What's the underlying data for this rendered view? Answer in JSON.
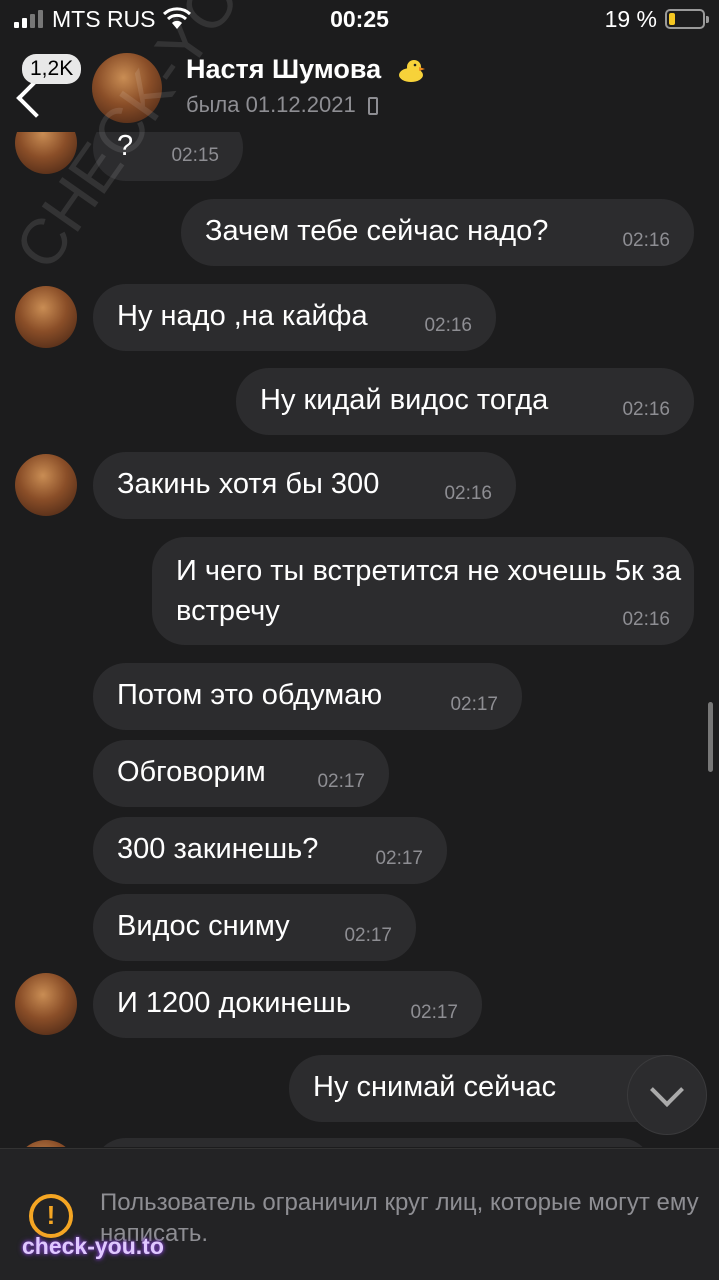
{
  "status_bar": {
    "carrier": "MTS RUS",
    "time": "00:25",
    "battery_percent_label": "19 %",
    "battery_level": 0.19,
    "icons": [
      "signal-icon",
      "wifi-icon",
      "battery-icon"
    ]
  },
  "header": {
    "unread_count": "1,2K",
    "contact_name": "Настя Шумова",
    "last_seen": "была 01.12.2021",
    "icons": [
      "back-chevron-icon",
      "duck-emoji-icon",
      "phone-device-icon"
    ]
  },
  "messages": [
    {
      "side": "in",
      "text": "?",
      "time": "02:15"
    },
    {
      "side": "out",
      "text": "Зачем тебе сейчас надо?",
      "time": "02:16"
    },
    {
      "side": "in",
      "text": "Ну надо ,на кайфа",
      "time": "02:16"
    },
    {
      "side": "out",
      "text": "Ну кидай видос тогда",
      "time": "02:16"
    },
    {
      "side": "in",
      "text": "Закинь хотя бы 300",
      "time": "02:16"
    },
    {
      "side": "out",
      "text": "И чего ты встретится не хочешь 5к за встречу",
      "time": "02:16"
    },
    {
      "side": "in",
      "text": "Потом это обдумаю",
      "time": "02:17"
    },
    {
      "side": "in",
      "text": "Обговорим",
      "time": "02:17"
    },
    {
      "side": "in",
      "text": "300 закинешь?",
      "time": "02:17"
    },
    {
      "side": "in",
      "text": "Видос сниму",
      "time": "02:17"
    },
    {
      "side": "in",
      "text": "И 1200 докинешь",
      "time": "02:17"
    },
    {
      "side": "out",
      "text": "Ну снимай сейчас",
      "time": ""
    }
  ],
  "restriction_notice": "Пользователь ограничил круг лиц, которые могут ему написать.",
  "watermarks": {
    "link": "check-you.to",
    "diagonal": "CHECK-YOU.ME"
  },
  "colors": {
    "background": "#1c1c1d",
    "bubble": "#2c2c2e",
    "time_text": "#8e8e93",
    "warning": "#f5a623",
    "battery": "#f5c722"
  }
}
